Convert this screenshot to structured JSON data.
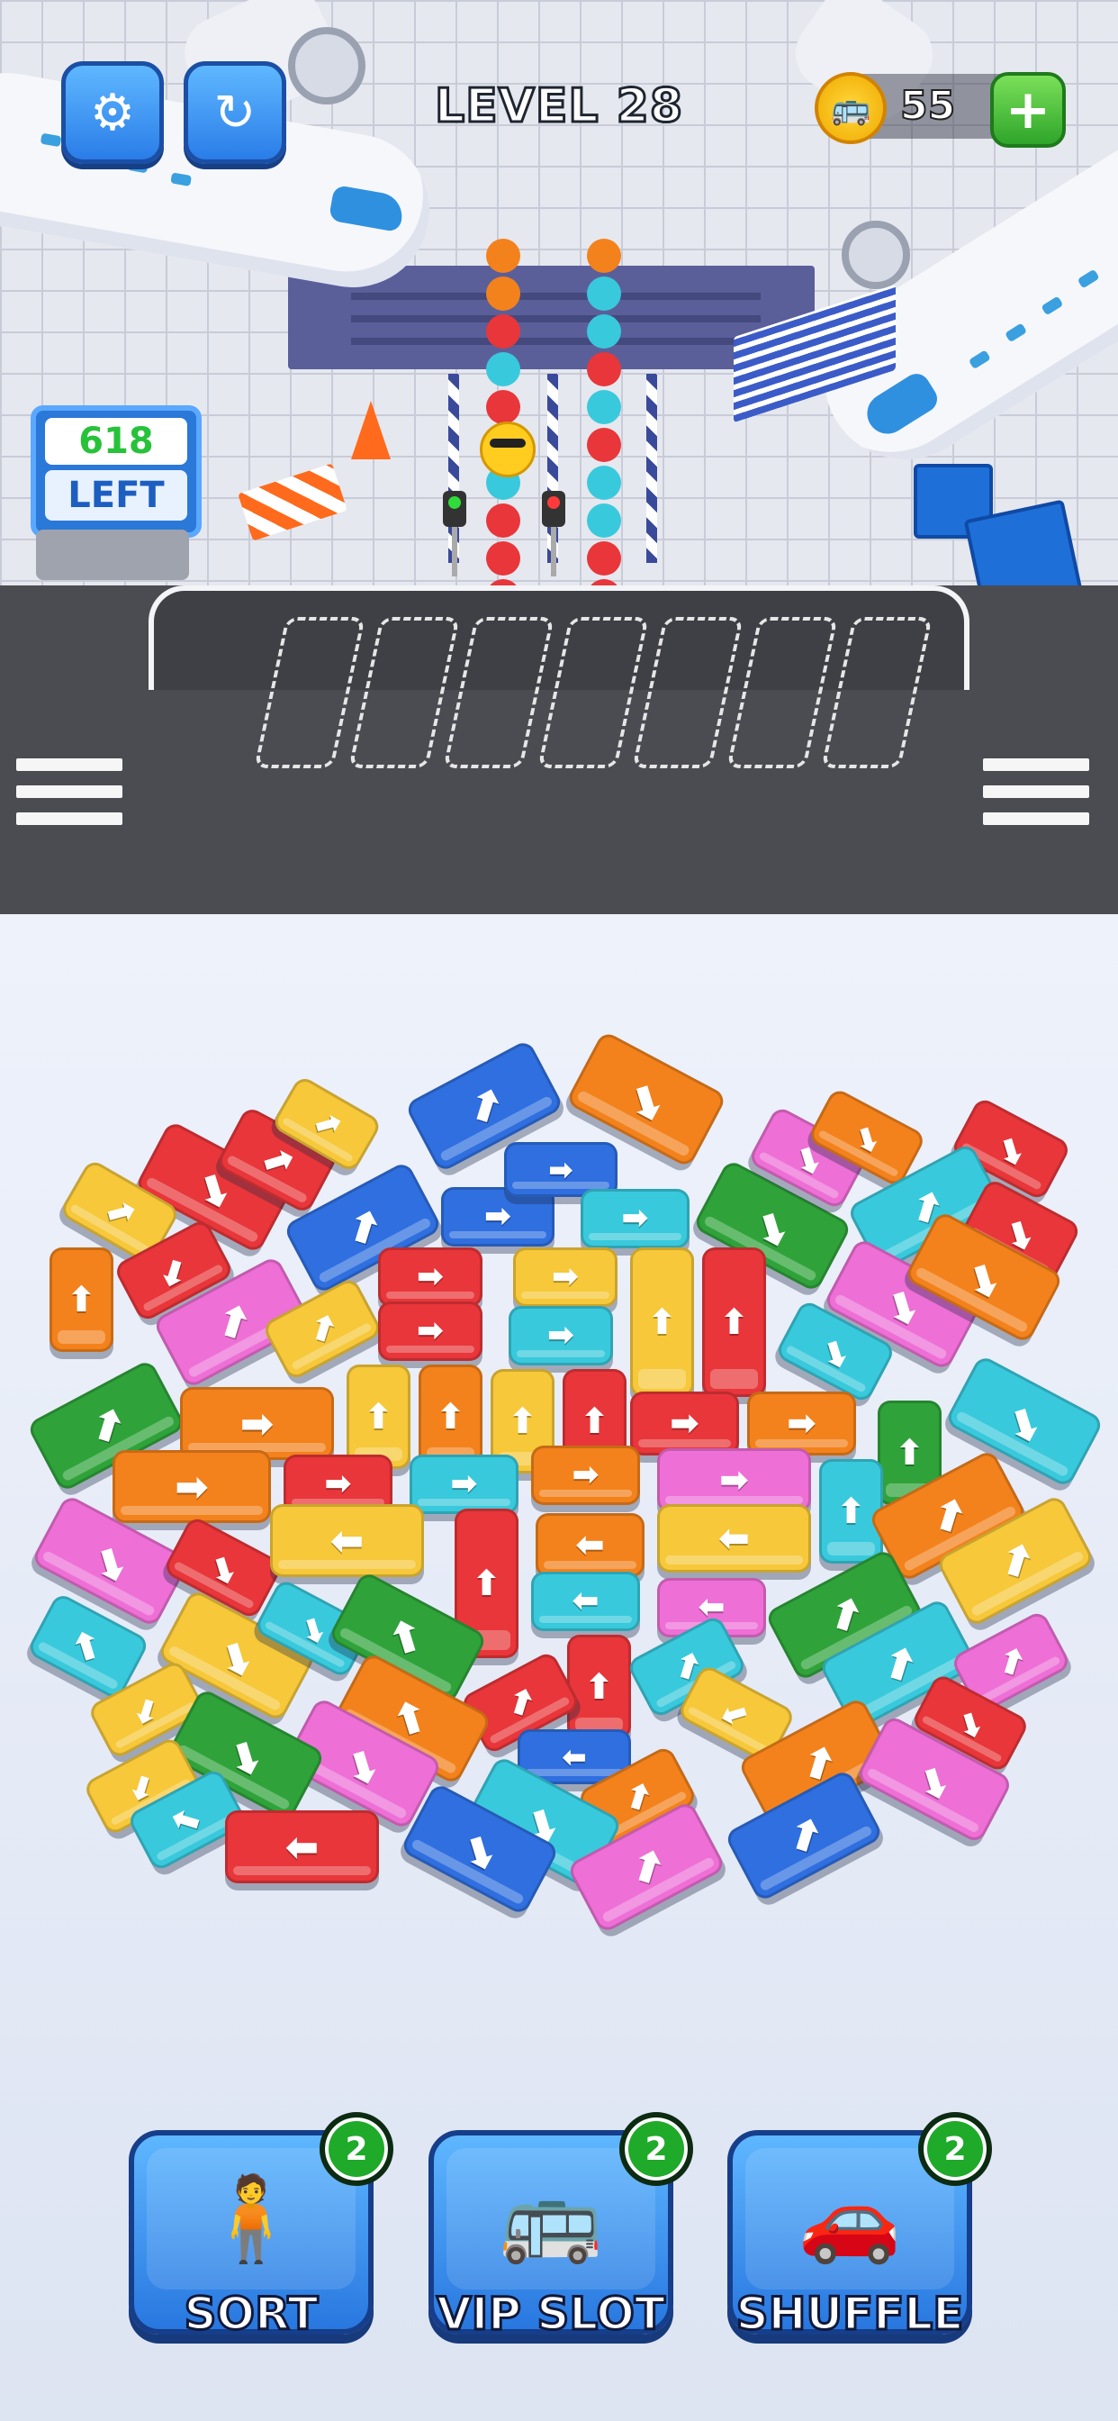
{
  "hud": {
    "level": "LEVEL 28",
    "coins": "55",
    "settings_icon": "gear-icon",
    "restart_icon": "restart-icon",
    "plus_icon": "plus-icon"
  },
  "passengers": {
    "count": "618",
    "label": "LEFT"
  },
  "boosters": [
    {
      "label": "SORT",
      "count": "2",
      "icon": "sort-person-icon"
    },
    {
      "label": "VIP SLOT",
      "count": "2",
      "icon": "vip-bus-icon"
    },
    {
      "label": "SHUFFLE",
      "count": "2",
      "icon": "shuffle-car-icon"
    }
  ],
  "colors": {
    "red": "#e8363a",
    "orange": "#f3821c",
    "yellow": "#f6c83a",
    "blue": "#2f6fe0",
    "cyan": "#39c9dc",
    "green": "#2fa33a",
    "pink": "#ee6fd6",
    "hud_blue": "#2a7de8"
  },
  "parking_slots": 7
}
